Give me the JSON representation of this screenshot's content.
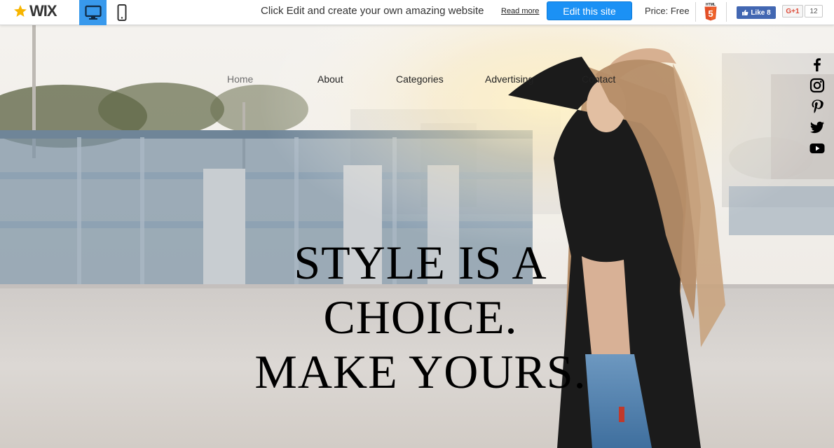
{
  "topbar": {
    "logo_text": "WIX",
    "view_desktop_icon": "desktop-icon",
    "view_mobile_icon": "mobile-icon",
    "promo_text": "Click Edit and create your own amazing website",
    "read_more": "Read more",
    "edit_button": "Edit this site",
    "price": "Price: Free",
    "html5_label": "HTML",
    "fb_like": "Like 8",
    "gplus_label": "G+1",
    "gplus_count": "12"
  },
  "nav": {
    "items": [
      {
        "label": "Home"
      },
      {
        "label": "About"
      },
      {
        "label": "Categories"
      },
      {
        "label": "Advertising"
      },
      {
        "label": "Contact"
      }
    ]
  },
  "social": [
    "facebook-icon",
    "instagram-icon",
    "pinterest-icon",
    "twitter-icon",
    "youtube-icon"
  ],
  "hero": {
    "line1": "STYLE IS A",
    "line2": "CHOICE.",
    "line3": "MAKE YOURS."
  },
  "colors": {
    "accent": "#3899ec",
    "edit_button": "#1b91f5",
    "facebook": "#4267b2",
    "gplus": "#dd4b39",
    "html5": "#e34f26"
  }
}
